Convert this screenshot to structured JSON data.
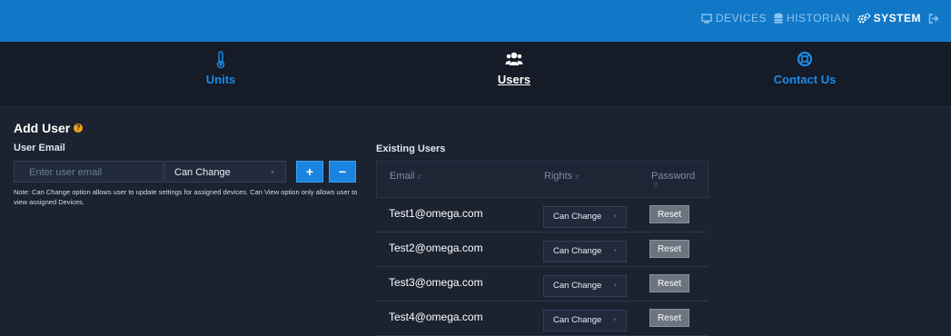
{
  "topnav": {
    "devices": "DEVICES",
    "historian": "HISTORIAN",
    "system": "SYSTEM"
  },
  "subnav": {
    "units": "Units",
    "users": "Users",
    "contact": "Contact Us"
  },
  "add_user": {
    "title": "Add User",
    "help_glyph": "?",
    "email_label": "User Email",
    "email_placeholder": "Enter user email",
    "rights_value": "Can Change",
    "add_symbol": "+",
    "remove_symbol": "−",
    "note": "Note: Can Change option allows user to update settings for assigned devices. Can View option only allows user to view assigned Devices."
  },
  "existing": {
    "label": "Existing Users",
    "columns": {
      "email": "Email",
      "rights": "Rights",
      "password": "Password"
    },
    "reset_label": "Reset",
    "rows": [
      {
        "email": "Test1@omega.com",
        "rights": "Can Change"
      },
      {
        "email": "Test2@omega.com",
        "rights": "Can Change"
      },
      {
        "email": "Test3@omega.com",
        "rights": "Can Change"
      },
      {
        "email": "Test4@omega.com",
        "rights": "Can Change"
      }
    ]
  },
  "colors": {
    "topbar": "#1178c8",
    "accent": "#1a8ae6",
    "background": "#1b2230"
  }
}
